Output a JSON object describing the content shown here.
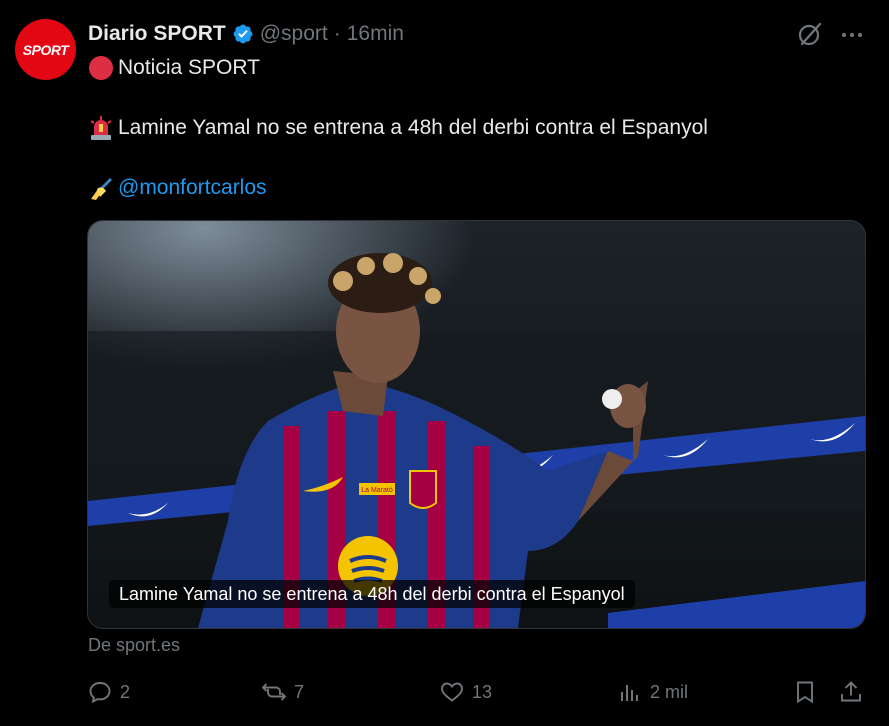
{
  "author": {
    "avatar_text": "SPORT",
    "display_name": "Diario SPORT",
    "handle": "@sport",
    "separator": "·",
    "time": "16min"
  },
  "tweet": {
    "line1": "Noticia SPORT",
    "line2": "Lamine Yamal no se entrena a 48h del derbi contra el Espanyol",
    "line3_mention": "@monfortcarlos"
  },
  "media": {
    "caption": "Lamine Yamal no se entrena a 48h del derbi contra el Espanyol",
    "badge_text": "La Marató"
  },
  "source": "De sport.es",
  "actions": {
    "replies": "2",
    "retweets": "7",
    "likes": "13",
    "views": "2 mil"
  },
  "colors": {
    "accent": "#1d9bf0",
    "brand": "#e30613",
    "muted": "#71767b",
    "text": "#e7e9ea",
    "background": "#000000"
  },
  "icons": [
    "verified-icon",
    "grok-icon",
    "more-icon",
    "red-circle-emoji",
    "siren-emoji",
    "writing-hand-emoji",
    "reply-icon",
    "retweet-icon",
    "like-icon",
    "views-icon",
    "bookmark-icon",
    "share-icon"
  ]
}
